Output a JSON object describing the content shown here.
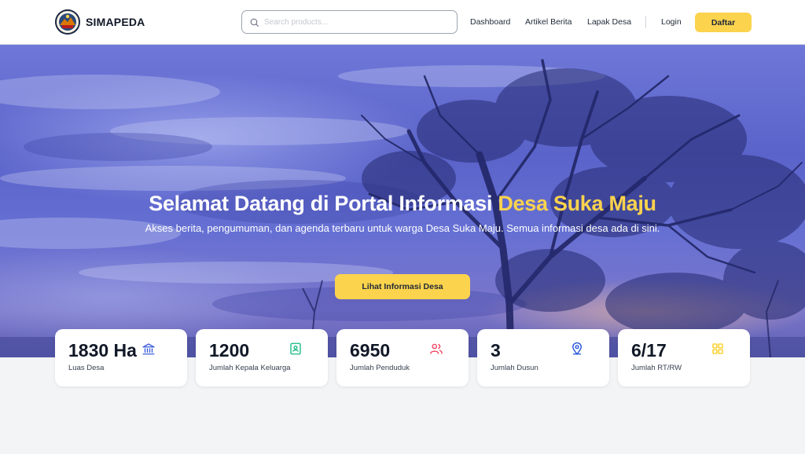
{
  "brand": {
    "name": "SIMAPEDA"
  },
  "search": {
    "placeholder": "Search products..."
  },
  "nav": {
    "links": [
      "Dashboard",
      "Artikel Berita",
      "Lapak Desa"
    ],
    "login": "Login",
    "register": "Daftar"
  },
  "hero": {
    "title_prefix": "Selamat Datang di Portal Informasi ",
    "title_highlight": "Desa Suka Maju",
    "subtitle": "Akses berita, pengumuman, dan agenda terbaru untuk warga Desa Suka Maju. Semua informasi desa ada di sini.",
    "button": "Lihat Informasi Desa"
  },
  "stats": [
    {
      "value": "1830 Ha",
      "label": "Luas Desa",
      "icon": "bank-icon",
      "color": "#3b5bdb"
    },
    {
      "value": "1200",
      "label": "Jumlah Kepala Keluarga",
      "icon": "contact-book-icon",
      "color": "#10b981"
    },
    {
      "value": "6950",
      "label": "Jumlah Penduduk",
      "icon": "users-icon",
      "color": "#f43f5e"
    },
    {
      "value": "3",
      "label": "Jumlah Dusun",
      "icon": "map-pin-icon",
      "color": "#1d4ed8"
    },
    {
      "value": "6/17",
      "label": "Jumlah RT/RW",
      "icon": "grid-icon",
      "color": "#facc15"
    }
  ],
  "colors": {
    "accent": "#fcd34d",
    "hero": "#5a63c9"
  }
}
